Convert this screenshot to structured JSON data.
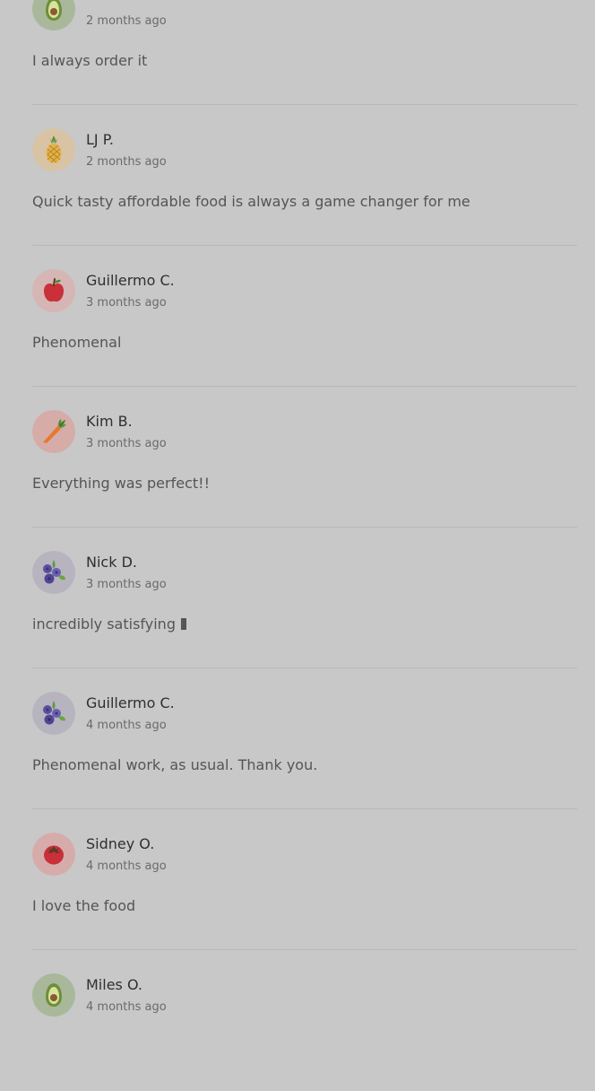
{
  "reviews": [
    {
      "name": "",
      "time": "2 months ago",
      "text": "I always order it",
      "avatar_icon": "avocado-icon",
      "avatar_bg": "#a9b89a"
    },
    {
      "name": "LJ P.",
      "time": "2 months ago",
      "text": "Quick tasty affordable food is always a game changer for me",
      "avatar_icon": "pineapple-icon",
      "avatar_bg": "#d8c3a5"
    },
    {
      "name": "Guillermo C.",
      "time": "3 months ago",
      "text": "Phenomenal",
      "avatar_icon": "apple-icon",
      "avatar_bg": "#d6b5b5"
    },
    {
      "name": "Kim B.",
      "time": "3 months ago",
      "text": "Everything was perfect!!",
      "avatar_icon": "carrot-icon",
      "avatar_bg": "#d6aca8"
    },
    {
      "name": "Nick D.",
      "time": "3 months ago",
      "text": "incredibly satisfying",
      "avatar_icon": "blueberry-icon",
      "avatar_bg": "#b7b4c0"
    },
    {
      "name": "Guillermo C.",
      "time": "4 months ago",
      "text": "Phenomenal work, as usual. Thank you.",
      "avatar_icon": "blueberry-icon",
      "avatar_bg": "#b7b4c0"
    },
    {
      "name": "Sidney O.",
      "time": "4 months ago",
      "text": "I love the food",
      "avatar_icon": "tomato-icon",
      "avatar_bg": "#d6acab"
    },
    {
      "name": "Miles O.",
      "time": "4 months ago",
      "text": "",
      "avatar_icon": "avocado-icon",
      "avatar_bg": "#a9b89a"
    }
  ]
}
